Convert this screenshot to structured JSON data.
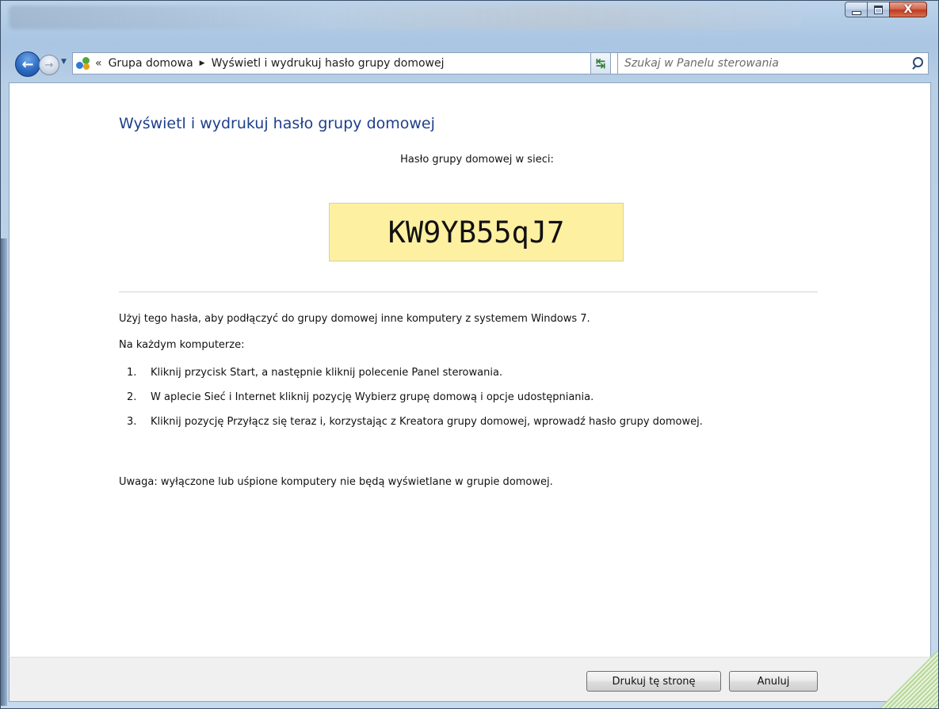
{
  "window": {
    "minimize_glyph": "—",
    "maximize_glyph": "□",
    "close_glyph": "X"
  },
  "navigation": {
    "back_icon": "←",
    "forward_icon": "→",
    "breadcrumb": {
      "overflow": "«",
      "items": [
        "Grupa domowa",
        "Wyświetl i wydrukuj hasło grupy domowej"
      ],
      "separator": "▶"
    },
    "dropdown_icon": "▼",
    "refresh_icon": "↹",
    "search_placeholder": "Szukaj w Panelu sterowania"
  },
  "main": {
    "title": "Wyświetl i wydrukuj hasło grupy domowej",
    "password_label": "Hasło grupy domowej w sieci:",
    "password": "KW9YB55qJ7",
    "intro": "Użyj tego hasła, aby podłączyć do grupy domowej inne komputery z systemem Windows 7.",
    "each_computer": "Na każdym komputerze:",
    "steps": [
      {
        "num": "1.",
        "text": "Kliknij przycisk Start, a następnie kliknij polecenie Panel sterowania."
      },
      {
        "num": "2.",
        "text": "W aplecie Sieć i Internet kliknij pozycję Wybierz grupę domową i opcje udostępniania."
      },
      {
        "num": "3.",
        "text": "Kliknij pozycję Przyłącz się teraz i, korzystając z Kreatora grupy domowej, wprowadź hasło grupy domowej."
      }
    ],
    "note": "Uwaga: wyłączone lub uśpione komputery nie będą wyświetlane w grupie domowej."
  },
  "footer": {
    "print_label": "Drukuj tę stronę",
    "cancel_label": "Anuluj"
  },
  "colors": {
    "title_blue": "#1e3f8a",
    "password_bg": "#fdf0a0",
    "close_red": "#c8452b"
  }
}
